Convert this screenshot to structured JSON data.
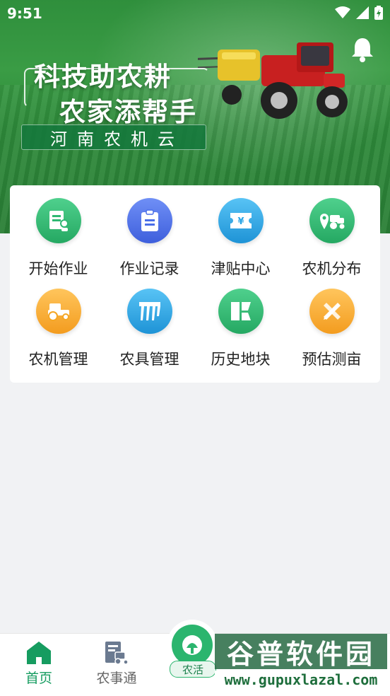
{
  "status_bar": {
    "time": "9:51",
    "icons": [
      "wifi-icon",
      "signal-icon",
      "battery-icon"
    ]
  },
  "header": {
    "notification_icon": "bell-icon",
    "slogan_line1": "科技助农耕",
    "slogan_line2": "农家添帮手",
    "brand_name": "河南农机云"
  },
  "menu": {
    "items": [
      {
        "label": "开始作业",
        "icon": "start-work-icon",
        "color": "#2eb872"
      },
      {
        "label": "作业记录",
        "icon": "clipboard-icon",
        "color": "#4a6ee8"
      },
      {
        "label": "津贴中心",
        "icon": "ticket-yuan-icon",
        "color": "#2ba6e6"
      },
      {
        "label": "农机分布",
        "icon": "map-tractor-icon",
        "color": "#2eb872"
      },
      {
        "label": "农机管理",
        "icon": "tractor-icon",
        "color": "#f5a623"
      },
      {
        "label": "农具管理",
        "icon": "harrow-icon",
        "color": "#2ba6e6"
      },
      {
        "label": "历史地块",
        "icon": "land-plot-icon",
        "color": "#2eb872"
      },
      {
        "label": "预估测亩",
        "icon": "ruler-pencil-icon",
        "color": "#f5a623"
      }
    ]
  },
  "tabbar": {
    "tabs": [
      {
        "label": "首页",
        "icon": "home-icon",
        "active": true
      },
      {
        "label": "农事通",
        "icon": "farm-doc-icon",
        "active": false
      }
    ],
    "center": {
      "label": "农活",
      "icon": "farm-work-icon"
    }
  },
  "watermark": {
    "title": "谷普软件园",
    "url": "www.gupuxlazal.com"
  },
  "colors": {
    "accent": "#169c60",
    "background": "#f1f2f4"
  }
}
